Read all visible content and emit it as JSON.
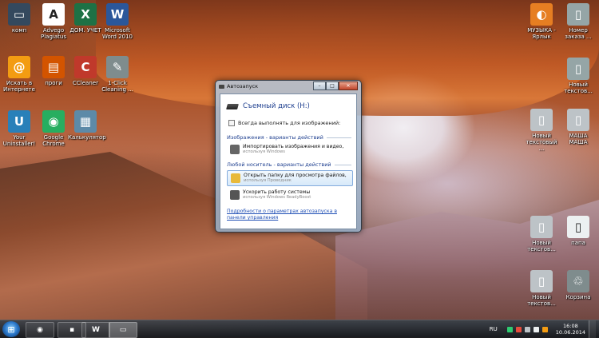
{
  "desktop": {
    "icons": [
      {
        "label": "комп",
        "glyph": "▭",
        "color": "#34495e"
      },
      {
        "label": "Advego Plagiatus",
        "glyph": "A",
        "color": "#ffffff"
      },
      {
        "label": "ДОМ. УЧЕТ",
        "glyph": "X",
        "color": "#1e7145"
      },
      {
        "label": "Microsoft Word 2010",
        "glyph": "W",
        "color": "#2b579a"
      },
      {
        "label": "Искать в Интернете",
        "glyph": "@",
        "color": "#f39c12"
      },
      {
        "label": "проги",
        "glyph": "▤",
        "color": "#d35400"
      },
      {
        "label": "CCleaner",
        "glyph": "C",
        "color": "#c0392b"
      },
      {
        "label": "1-Click Cleaning ...",
        "glyph": "✎",
        "color": "#7f8c8d"
      },
      {
        "label": "Your Uninstaller!",
        "glyph": "U",
        "color": "#2980b9"
      },
      {
        "label": "Google Chrome",
        "glyph": "◉",
        "color": "#27ae60"
      },
      {
        "label": "Калькулятор",
        "glyph": "▦",
        "color": "#5d8aa8"
      },
      {
        "label": "МУЗЫКА - Ярлык",
        "glyph": "◐",
        "color": "#e67e22"
      },
      {
        "label": "Номер заказа ...",
        "glyph": "▯",
        "color": "#95a5a6"
      },
      {
        "label": "Новый текстов...",
        "glyph": "▯",
        "color": "#95a5a6"
      },
      {
        "label": "Новый текстовый ...",
        "glyph": "▯",
        "color": "#bdc3c7"
      },
      {
        "label": "МАША МАША",
        "glyph": "▯",
        "color": "#bdc3c7"
      },
      {
        "label": "Новый текстов...",
        "glyph": "▯",
        "color": "#bdc3c7"
      },
      {
        "label": "папа",
        "glyph": "▯",
        "color": "#ecf0f1"
      },
      {
        "label": "Новый текстов...",
        "glyph": "▯",
        "color": "#bdc3c7"
      },
      {
        "label": "Корзина",
        "glyph": "♲",
        "color": "#7f8c8d"
      }
    ]
  },
  "dialog": {
    "title": "Автозапуск",
    "minimize": "–",
    "maximize": "□",
    "close": "✕",
    "drive_title": "Съемный диск (H:)",
    "always_label": "Всегда выполнять для изображений:",
    "section_images": "Изображения - варианты действий",
    "section_general": "Любой носитель - варианты действий",
    "options": [
      {
        "main": "Импортировать изображения и видео,",
        "sub": "используя Windows",
        "color": "#666666"
      },
      {
        "main": "Открыть папку для просмотра файлов,",
        "sub": "используя Проводник",
        "color": "#e8b93a"
      },
      {
        "main": "Ускорить работу системы",
        "sub": "используя Windows ReadyBoost",
        "color": "#555555"
      }
    ],
    "link": "Подробности о параметрах автозапуска в панели управления"
  },
  "taskbar": {
    "start_glyph": "⊞",
    "items": [
      {
        "label": "◉",
        "name": "taskbar-chrome"
      },
      {
        "label": "▪",
        "name": "taskbar-app"
      },
      {
        "label": "W",
        "name": "taskbar-word"
      },
      {
        "label": "▭",
        "name": "taskbar-explorer"
      }
    ],
    "lang": "RU",
    "time": "16:08",
    "date": "10.06.2014"
  }
}
